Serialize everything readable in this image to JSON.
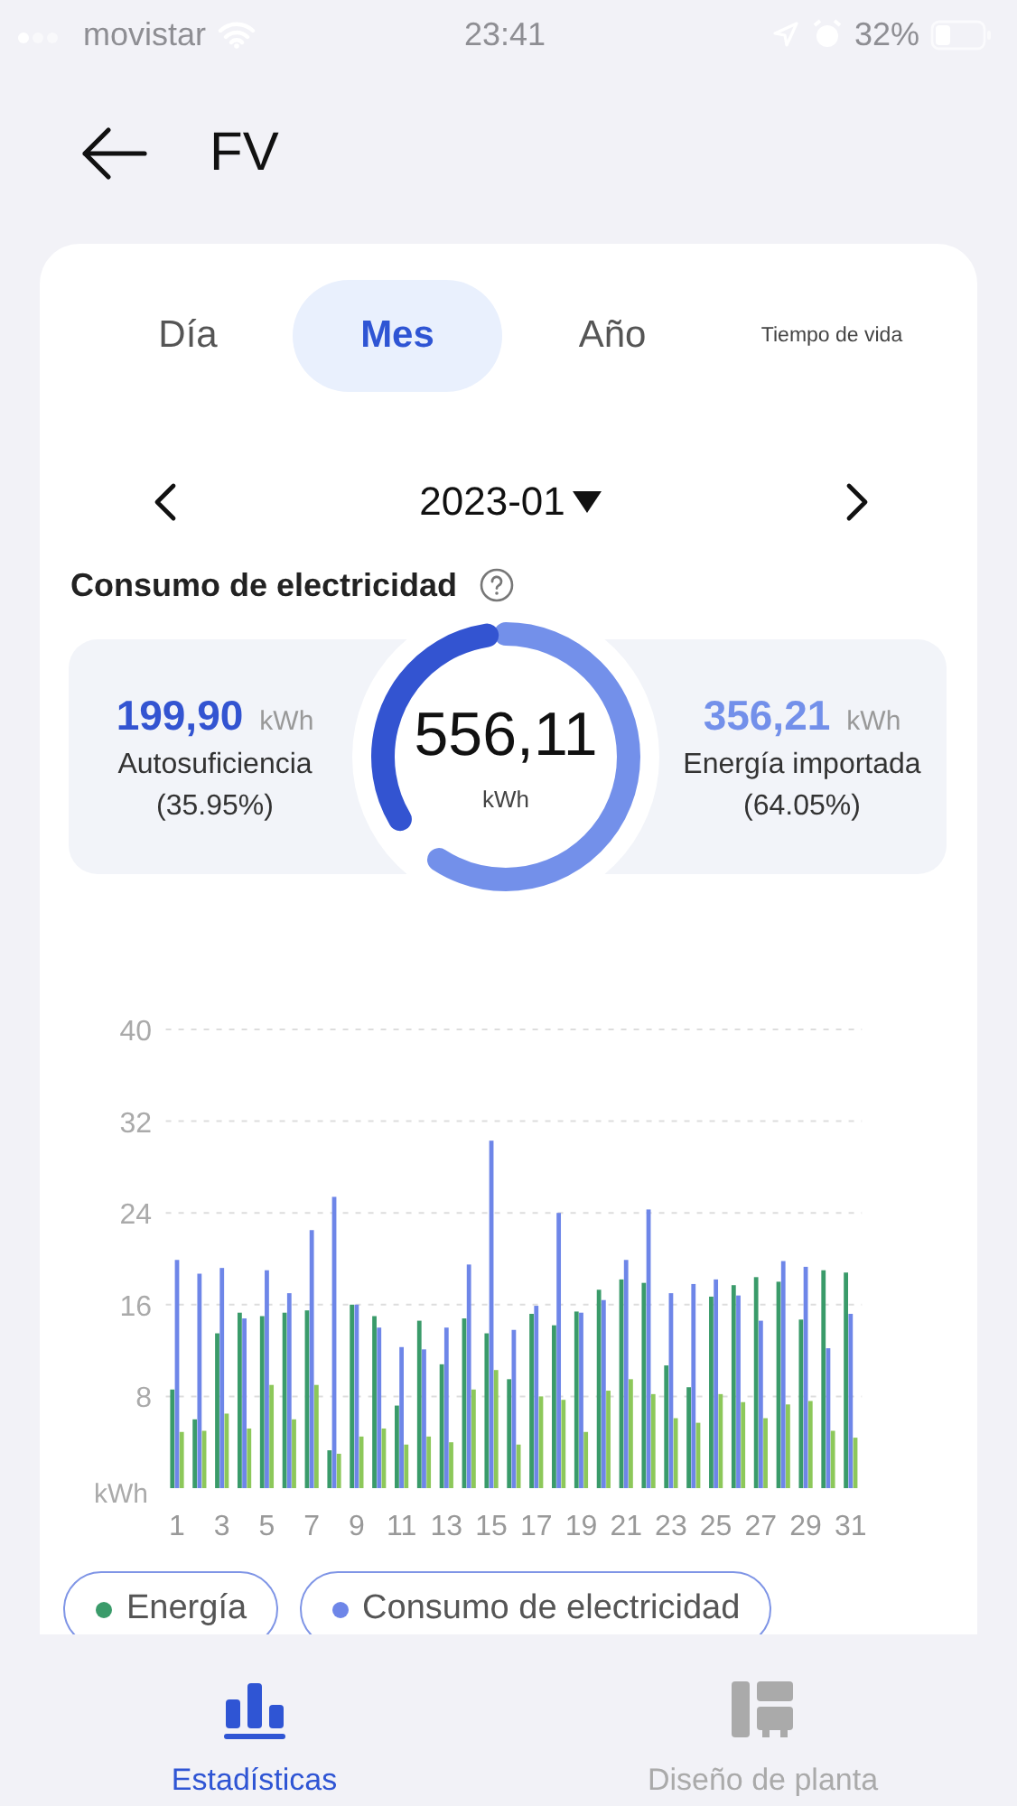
{
  "status_bar": {
    "carrier": "movistar",
    "time": "23:41",
    "battery": "32%"
  },
  "header": {
    "title": "FV"
  },
  "tabs": [
    {
      "label": "Día",
      "selected": false
    },
    {
      "label": "Mes",
      "selected": true
    },
    {
      "label": "Año",
      "selected": false
    },
    {
      "label": "Tiempo de vida",
      "selected": false,
      "kind": "small"
    }
  ],
  "period": {
    "value": "2023-01"
  },
  "section_title": "Consumo de electricidad",
  "summary": {
    "total": "556,11",
    "total_unit": "kWh",
    "ring": {
      "level": 0.3595
    },
    "left": {
      "value": "199,90",
      "unit": "kWh",
      "label": "Autosuficiencia",
      "percent": "(35.95%)",
      "color": "#3354d1"
    },
    "right": {
      "value": "356,21",
      "unit": "kWh",
      "label": "Energía importada",
      "percent": "(64.05%)",
      "color": "#7390ea"
    }
  },
  "chart_data": {
    "type": "bar",
    "ylabel": "kWh",
    "x": [
      1,
      2,
      3,
      4,
      5,
      6,
      7,
      8,
      9,
      10,
      11,
      12,
      13,
      14,
      15,
      16,
      17,
      18,
      19,
      20,
      21,
      22,
      23,
      24,
      25,
      26,
      27,
      28,
      29,
      30,
      31
    ],
    "xticks": [
      1,
      3,
      5,
      7,
      9,
      11,
      13,
      15,
      17,
      19,
      21,
      23,
      25,
      27,
      29,
      31
    ],
    "xlim": [
      0.5,
      31.5
    ],
    "ylim": [
      0,
      40
    ],
    "grid": true,
    "yticks": [
      8,
      16,
      24,
      32,
      40
    ],
    "series": [
      {
        "name": "Energía",
        "color": "#3a9b6a",
        "values": [
          8.6,
          6,
          13.5,
          15.3,
          15,
          15.3,
          15.5,
          3.3,
          16,
          15,
          7.2,
          14.6,
          10.8,
          14.8,
          13.5,
          9.5,
          15.2,
          14.2,
          15.4,
          17.3,
          18.2,
          17.9,
          10.7,
          8.8,
          16.7,
          17.7,
          18.4,
          18,
          14.7,
          19,
          18.8
        ]
      },
      {
        "name": "Consumo de electricidad",
        "color": "#6e86e8",
        "values": [
          19.9,
          18.7,
          19.2,
          14.8,
          19,
          17,
          22.5,
          25.4,
          16,
          14,
          12.3,
          12.1,
          14,
          19.5,
          30.3,
          13.8,
          15.9,
          24,
          15.3,
          16.4,
          19.9,
          24.3,
          17,
          17.8,
          18.2,
          16.8,
          14.6,
          19.8,
          19.3,
          12.2,
          15.2
        ]
      },
      {
        "color": "#8dc85a",
        "values": [
          4.9,
          5,
          6.5,
          5.2,
          9,
          6,
          9,
          3,
          4.5,
          5.2,
          3.8,
          4.5,
          4,
          8.6,
          10.3,
          3.8,
          8,
          7.7,
          4.9,
          8.5,
          9.5,
          8.2,
          6.1,
          5.7,
          8.2,
          7.5,
          6.1,
          7.3,
          7.6,
          5,
          4.4
        ]
      }
    ]
  },
  "nav": [
    {
      "label": "Estadísticas",
      "selected": true,
      "kind": "stats"
    },
    {
      "label": "Diseño de planta",
      "selected": false,
      "kind": "layout"
    }
  ]
}
